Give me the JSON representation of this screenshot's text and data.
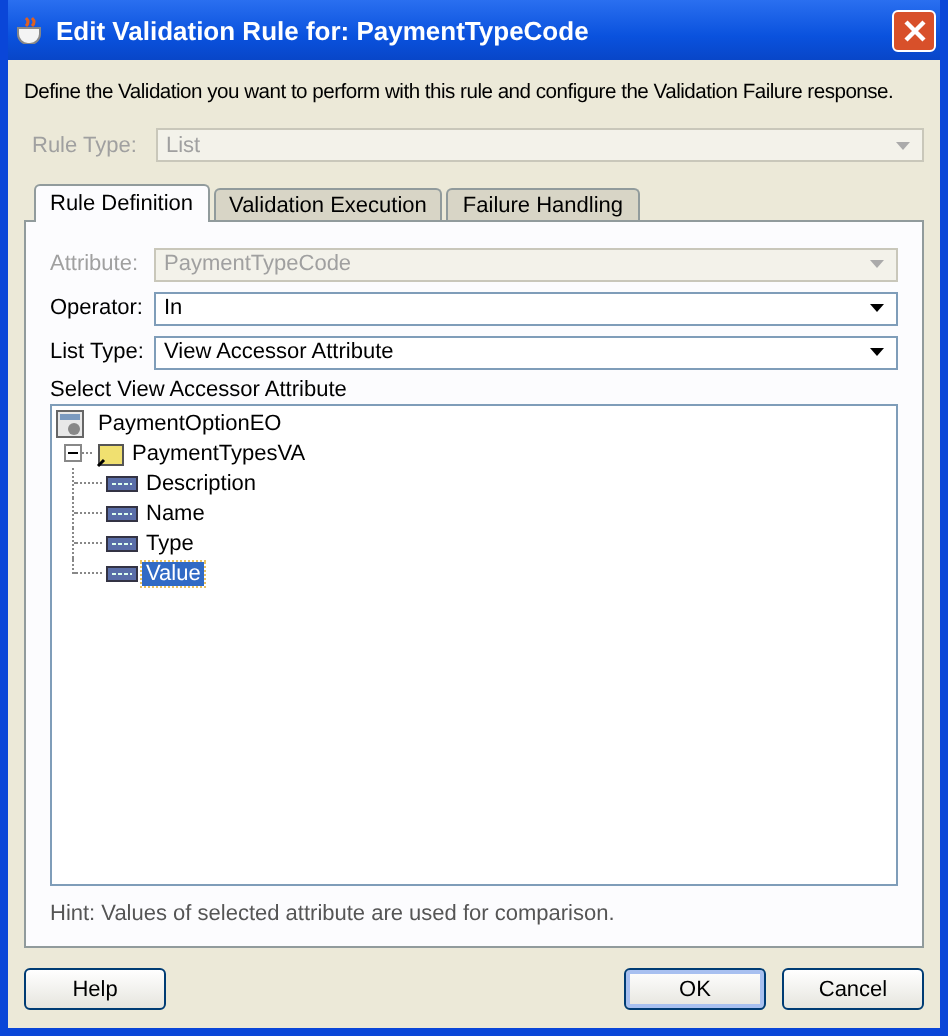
{
  "window": {
    "title": "Edit Validation Rule for: PaymentTypeCode"
  },
  "description": "Define the Validation you want to perform with this rule and configure the Validation Failure response.",
  "rule_type": {
    "label": "Rule Type:",
    "value": "List",
    "disabled": true
  },
  "tabs": [
    {
      "label": "Rule Definition",
      "selected": true
    },
    {
      "label": "Validation Execution",
      "selected": false
    },
    {
      "label": "Failure Handling",
      "selected": false
    }
  ],
  "fields": [
    {
      "label": "Attribute:",
      "value": "PaymentTypeCode",
      "disabled": true
    },
    {
      "label": "Operator:",
      "value": "In",
      "disabled": false
    },
    {
      "label": "List Type:",
      "value": "View Accessor Attribute",
      "disabled": false
    }
  ],
  "tree": {
    "label": "Select View Accessor Attribute",
    "items": [
      {
        "label": "PaymentOptionEO",
        "kind": "entity",
        "selected": false,
        "children": [
          {
            "label": "PaymentTypesVA",
            "kind": "accessor",
            "expanded": true,
            "selected": false,
            "children": [
              {
                "label": "Description",
                "kind": "attribute",
                "selected": false
              },
              {
                "label": "Name",
                "kind": "attribute",
                "selected": false
              },
              {
                "label": "Type",
                "kind": "attribute",
                "selected": false
              },
              {
                "label": "Value",
                "kind": "attribute",
                "selected": true
              }
            ]
          }
        ]
      }
    ]
  },
  "hint": "Hint: Values of selected attribute are used for comparison.",
  "buttons": [
    {
      "label": "Help",
      "default": false
    },
    {
      "label": "OK",
      "default": true
    },
    {
      "label": "Cancel",
      "default": false
    }
  ]
}
